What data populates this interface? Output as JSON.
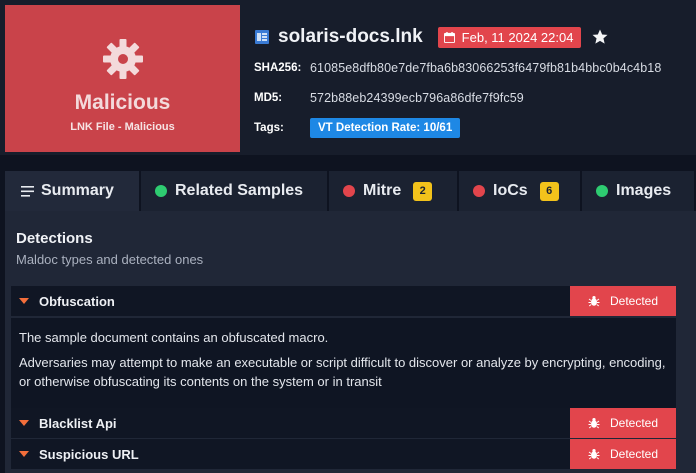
{
  "verdict": {
    "title": "Malicious",
    "subtitle": "LNK File - Malicious",
    "color": "#c9434a"
  },
  "file": {
    "name": "solaris-docs.lnk",
    "date": "Feb, 11 2024 22:04",
    "sha256_label": "SHA256:",
    "sha256": "61085e8dfb80e7de7fba6b83066253f6479fb81b4bbc0b4c4b18",
    "md5_label": "MD5:",
    "md5": "572b88eb24399ecb796a86dfe7f9fc59",
    "tags_label": "Tags:",
    "tag": "VT Detection Rate: 10/61"
  },
  "tabs": [
    {
      "label": "Summary",
      "icon": "list-icon"
    },
    {
      "label": "Related Samples",
      "icon": "green-dot",
      "color": "#2ecc71"
    },
    {
      "label": "Mitre",
      "icon": "red-dot",
      "color": "#e2454c",
      "badge": "2"
    },
    {
      "label": "IoCs",
      "icon": "red-dot",
      "color": "#e2454c",
      "badge": "6"
    },
    {
      "label": "Images",
      "icon": "green-dot",
      "color": "#2ecc71"
    }
  ],
  "detections": {
    "title": "Detections",
    "subtitle": "Maldoc types and detected ones",
    "status_label": "Detected",
    "items": [
      {
        "label": "Obfuscation",
        "description": [
          "The sample document contains an obfuscated macro.",
          "Adversaries may attempt to make an executable or script difficult to discover or analyze by encrypting, encoding, or otherwise obfuscating its contents on the system or in transit"
        ]
      },
      {
        "label": "Blacklist Api"
      },
      {
        "label": "Suspicious URL"
      }
    ]
  }
}
